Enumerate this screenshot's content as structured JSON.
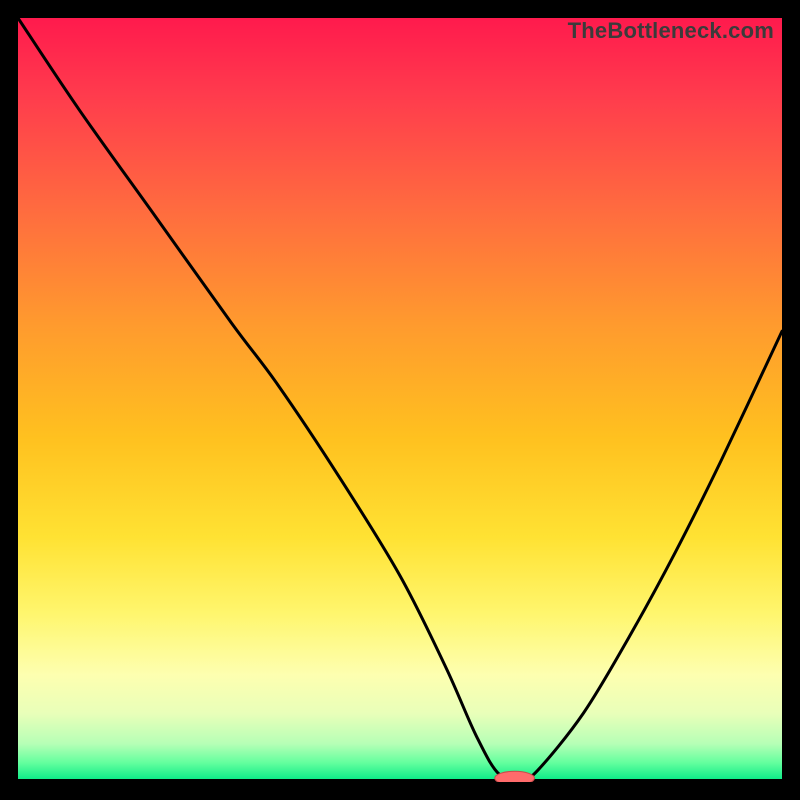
{
  "watermark": "TheBottleneck.com",
  "colors": {
    "frame": "#000000",
    "curve": "#000000",
    "marker_fill": "#ff6b6b",
    "marker_stroke": "#c74a4a"
  },
  "chart_data": {
    "type": "line",
    "title": "",
    "xlabel": "",
    "ylabel": "",
    "xlim": [
      0,
      100
    ],
    "ylim": [
      0,
      100
    ],
    "grid": false,
    "series": [
      {
        "name": "bottleneck-curve",
        "x": [
          0,
          8,
          18,
          28,
          34,
          42,
          50,
          56,
          60,
          63,
          66,
          68,
          74,
          80,
          86,
          92,
          100
        ],
        "values": [
          100,
          88,
          74,
          60,
          52,
          40,
          27,
          15,
          6,
          1,
          0.5,
          1.5,
          9,
          19,
          30,
          42,
          59
        ]
      }
    ],
    "marker": {
      "x": 65,
      "y": 0.5,
      "rx": 2.6,
      "ry": 0.9
    }
  }
}
